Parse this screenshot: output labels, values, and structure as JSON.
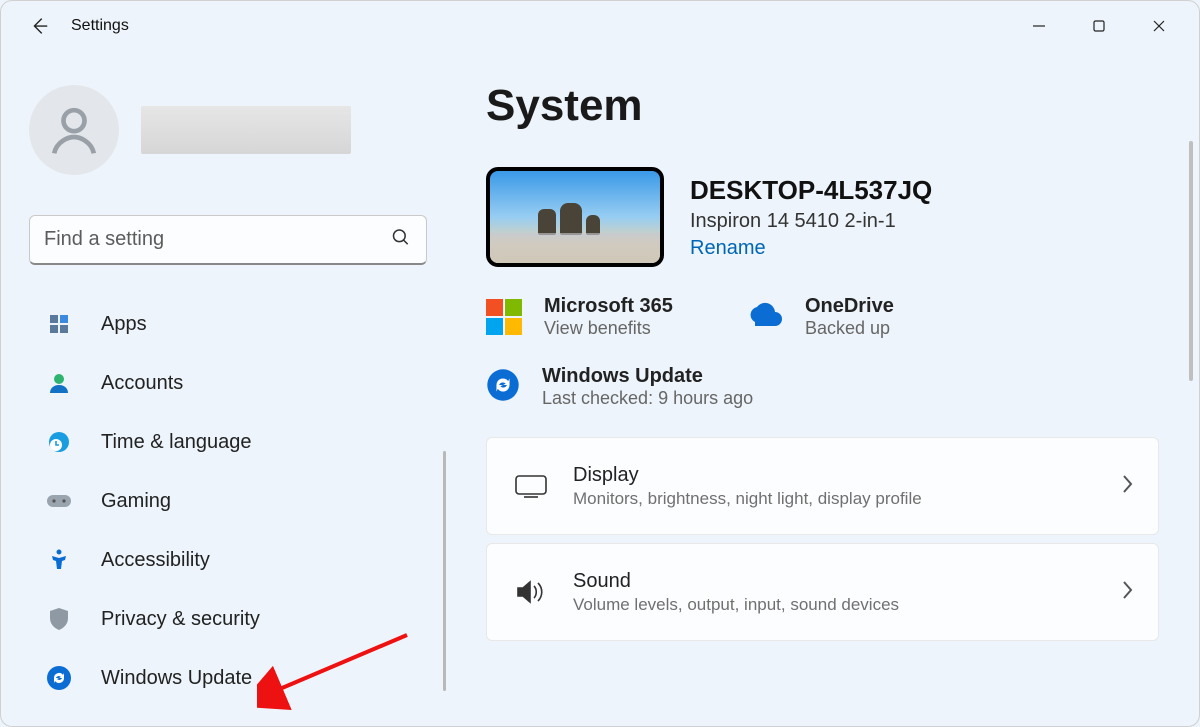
{
  "app_title": "Settings",
  "search_placeholder": "Find a setting",
  "sidebar": {
    "items": [
      {
        "label": "Apps"
      },
      {
        "label": "Accounts"
      },
      {
        "label": "Time & language"
      },
      {
        "label": "Gaming"
      },
      {
        "label": "Accessibility"
      },
      {
        "label": "Privacy & security"
      },
      {
        "label": "Windows Update"
      }
    ]
  },
  "main": {
    "heading": "System",
    "device_name": "DESKTOP-4L537JQ",
    "device_model": "Inspiron 14 5410 2-in-1",
    "rename_label": "Rename",
    "ms365_title": "Microsoft 365",
    "ms365_sub": "View benefits",
    "onedrive_title": "OneDrive",
    "onedrive_sub": "Backed up",
    "update_title": "Windows Update",
    "update_sub": "Last checked: 9 hours ago",
    "display_title": "Display",
    "display_sub": "Monitors, brightness, night light, display profile",
    "sound_title": "Sound",
    "sound_sub": "Volume levels, output, input, sound devices"
  }
}
